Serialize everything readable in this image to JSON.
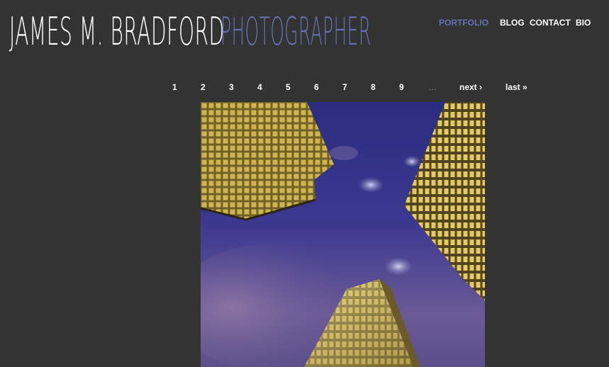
{
  "header": {
    "name": "JAMES M. BRADFORD",
    "title": "PHOTOGRAPHER"
  },
  "nav": {
    "items": [
      {
        "label": "PORTFOLIO",
        "active": true
      },
      {
        "label": "BLOG",
        "active": false
      },
      {
        "label": "CONTACT",
        "active": false
      },
      {
        "label": "BIO",
        "active": false
      }
    ]
  },
  "pager": {
    "pages": [
      "1",
      "2",
      "3",
      "4",
      "5",
      "6",
      "7",
      "8",
      "9"
    ],
    "ellipsis": "…",
    "next": "next ›",
    "last": "last »"
  },
  "photo": {
    "subject": "looking up at illuminated skyscrapers against a purple night sky"
  },
  "colors": {
    "background": "#333333",
    "accent": "#6670b2",
    "text": "#ffffff"
  }
}
